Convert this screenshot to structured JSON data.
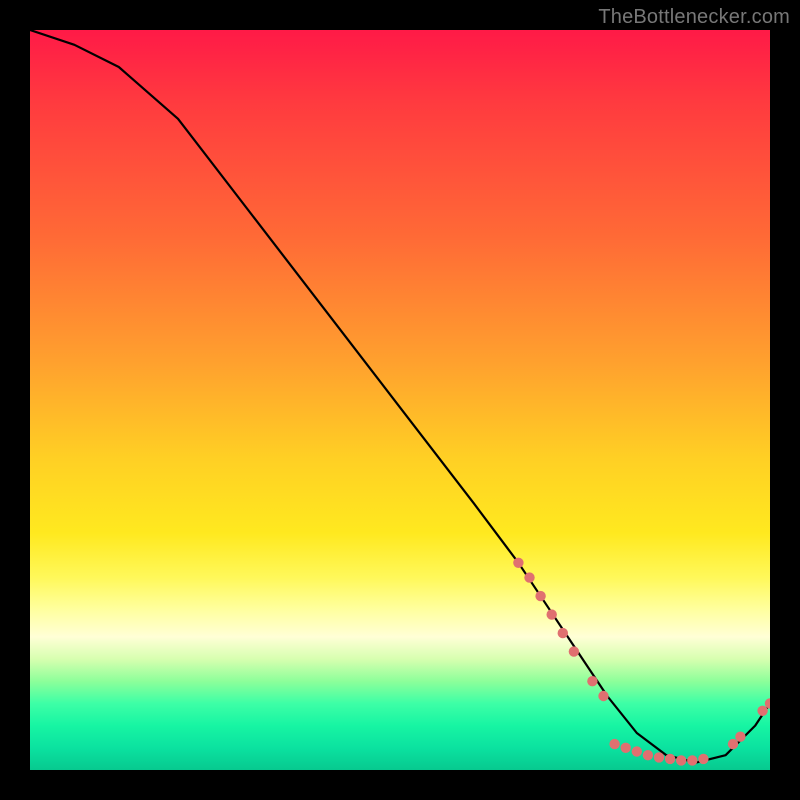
{
  "watermark": "TheBottlenecker.com",
  "chart_data": {
    "type": "line",
    "title": "",
    "xlabel": "",
    "ylabel": "",
    "xlim": [
      0,
      100
    ],
    "ylim": [
      0,
      100
    ],
    "series": [
      {
        "name": "curve",
        "x": [
          0,
          6,
          12,
          20,
          30,
          40,
          50,
          60,
          66,
          70,
          74,
          78,
          82,
          86,
          90,
          94,
          98,
          100
        ],
        "values": [
          100,
          98,
          95,
          88,
          75,
          62,
          49,
          36,
          28,
          22,
          16,
          10,
          5,
          2,
          1,
          2,
          6,
          9
        ]
      }
    ],
    "markers": [
      {
        "kind": "cluster-upper",
        "x": 66,
        "y": 28
      },
      {
        "kind": "cluster-upper",
        "x": 67.5,
        "y": 26
      },
      {
        "kind": "cluster-upper",
        "x": 69,
        "y": 23.5
      },
      {
        "kind": "cluster-upper",
        "x": 70.5,
        "y": 21
      },
      {
        "kind": "cluster-upper",
        "x": 72,
        "y": 18.5
      },
      {
        "kind": "cluster-upper",
        "x": 73.5,
        "y": 16
      },
      {
        "kind": "mid",
        "x": 76,
        "y": 12
      },
      {
        "kind": "mid",
        "x": 77.5,
        "y": 10
      },
      {
        "kind": "bottom-row",
        "x": 79,
        "y": 3.5
      },
      {
        "kind": "bottom-row",
        "x": 80.5,
        "y": 3
      },
      {
        "kind": "bottom-row",
        "x": 82,
        "y": 2.5
      },
      {
        "kind": "bottom-row",
        "x": 83.5,
        "y": 2
      },
      {
        "kind": "bottom-row",
        "x": 85,
        "y": 1.7
      },
      {
        "kind": "bottom-row",
        "x": 86.5,
        "y": 1.5
      },
      {
        "kind": "bottom-row",
        "x": 88,
        "y": 1.3
      },
      {
        "kind": "bottom-row",
        "x": 89.5,
        "y": 1.3
      },
      {
        "kind": "bottom-row",
        "x": 91,
        "y": 1.5
      },
      {
        "kind": "right-tail",
        "x": 95,
        "y": 3.5
      },
      {
        "kind": "right-tail",
        "x": 96,
        "y": 4.5
      },
      {
        "kind": "right-end",
        "x": 99,
        "y": 8
      },
      {
        "kind": "right-end",
        "x": 100,
        "y": 9
      }
    ],
    "marker_color": "#e07070",
    "line_color": "#000000",
    "colors": {
      "top": "#ff1a47",
      "mid": "#ffe91f",
      "bottom": "#07c98f"
    }
  }
}
